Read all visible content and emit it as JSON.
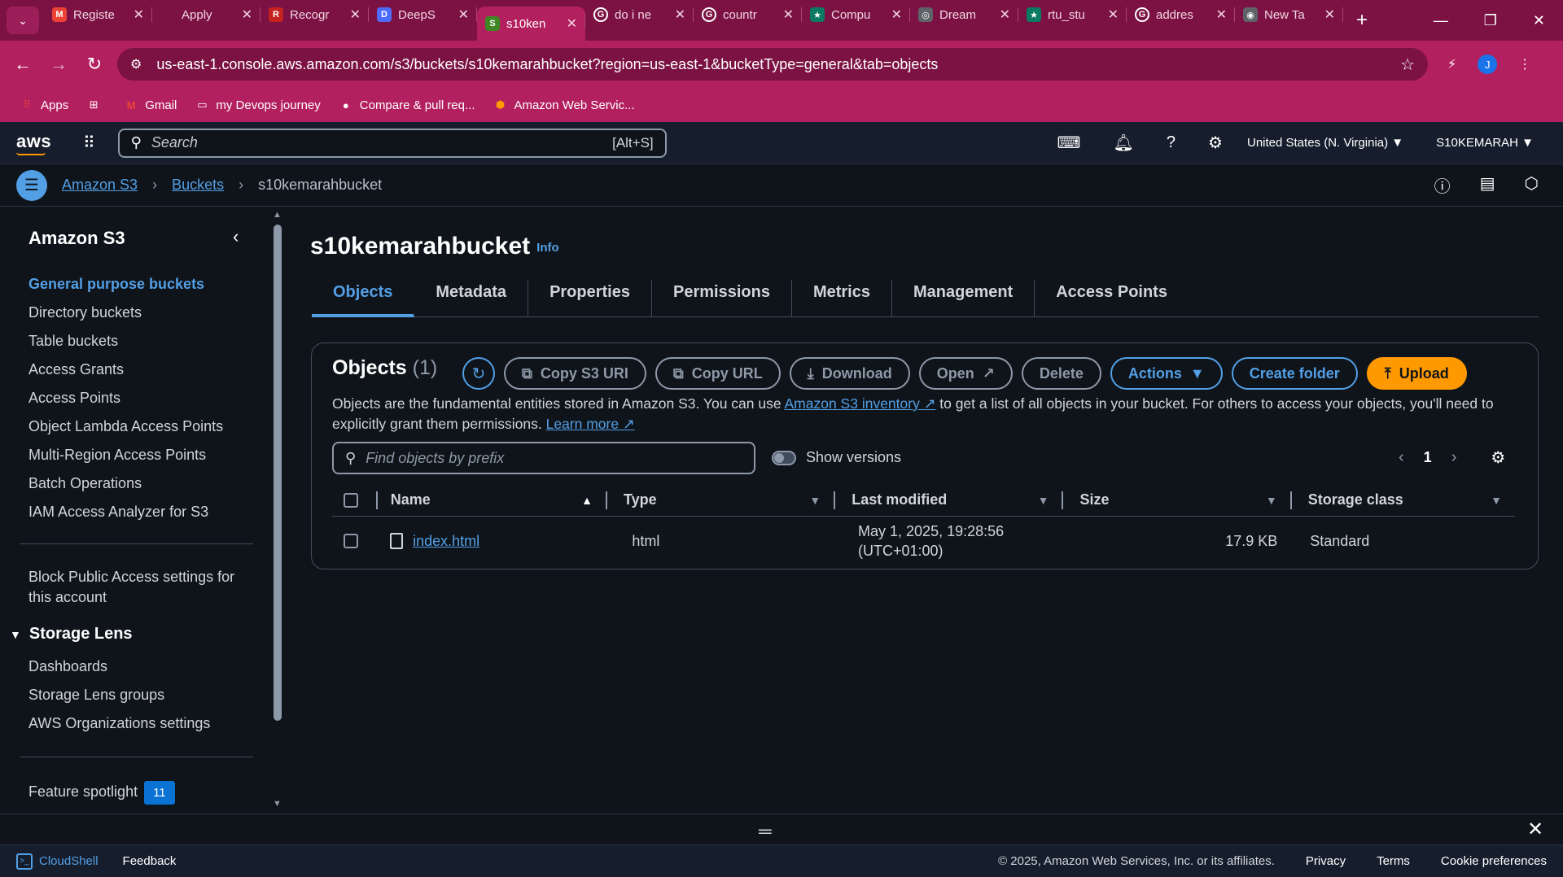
{
  "browser": {
    "tabs": [
      {
        "label": "Registe",
        "fav_color": "#ea4335",
        "fav_char": "M"
      },
      {
        "label": "Apply",
        "fav_color": "#7b1243",
        "fav_char": ""
      },
      {
        "label": "Recogr",
        "fav_color": "#c5221f",
        "fav_char": "R"
      },
      {
        "label": "DeepS",
        "fav_color": "#4d6bfe",
        "fav_char": "D"
      },
      {
        "label": "s10ken",
        "fav_color": "#3f8624",
        "fav_char": "S",
        "active": true
      },
      {
        "label": "do i ne",
        "fav_color": "#ffffff",
        "fav_char": "G"
      },
      {
        "label": "countr",
        "fav_color": "#ffffff",
        "fav_char": "G"
      },
      {
        "label": "Compu",
        "fav_color": "#0a7a62",
        "fav_char": "★"
      },
      {
        "label": "Dream",
        "fav_color": "#5f6368",
        "fav_char": "◎"
      },
      {
        "label": "rtu_stu",
        "fav_color": "#0a7a62",
        "fav_char": "★"
      },
      {
        "label": "addres",
        "fav_color": "#ffffff",
        "fav_char": "G"
      },
      {
        "label": "New Ta",
        "fav_color": "#5f6368",
        "fav_char": "◉"
      }
    ],
    "url": "us-east-1.console.aws.amazon.com/s3/buckets/s10kemarahbucket?region=us-east-1&bucketType=general&tab=objects",
    "profile_initial": "J",
    "bookmarks": [
      {
        "label": "Apps",
        "icon": "apps-grid-icon"
      },
      {
        "label": "",
        "icon": "tab-groups-icon"
      },
      {
        "label": "Gmail",
        "icon": "gmail-icon"
      },
      {
        "label": "my Devops journey",
        "icon": "folder-icon"
      },
      {
        "label": "Compare & pull req...",
        "icon": "github-icon"
      },
      {
        "label": "Amazon Web Servic...",
        "icon": "aws-cube-icon"
      }
    ]
  },
  "aws": {
    "logo": "aws",
    "search_placeholder": "Search",
    "search_shortcut": "[Alt+S]",
    "region": "United States (N. Virginia) ▼",
    "account": "S10KEMARAH ▼"
  },
  "breadcrumbs": {
    "items": [
      "Amazon S3",
      "Buckets"
    ],
    "current": "s10kemarahbucket"
  },
  "sidebar": {
    "title": "Amazon S3",
    "items": [
      {
        "label": "General purpose buckets",
        "active": true
      },
      {
        "label": "Directory buckets"
      },
      {
        "label": "Table buckets"
      },
      {
        "label": "Access Grants"
      },
      {
        "label": "Access Points"
      },
      {
        "label": "Object Lambda Access Points"
      },
      {
        "label": "Multi-Region Access Points"
      },
      {
        "label": "Batch Operations"
      },
      {
        "label": "IAM Access Analyzer for S3"
      }
    ],
    "block_public": "Block Public Access settings for this account",
    "storage_lens": "Storage Lens",
    "storage_lens_items": [
      "Dashboards",
      "Storage Lens groups",
      "AWS Organizations settings"
    ],
    "feature_spotlight": "Feature spotlight",
    "feature_spotlight_count": "11"
  },
  "main": {
    "bucket_name": "s10kemarahbucket",
    "info": "Info",
    "tabs": [
      "Objects",
      "Metadata",
      "Properties",
      "Permissions",
      "Metrics",
      "Management",
      "Access Points"
    ],
    "objects_title": "Objects",
    "objects_count": "(1)",
    "buttons": {
      "copy_s3_uri": "Copy S3 URI",
      "copy_url": "Copy URL",
      "download": "Download",
      "open": "Open",
      "delete": "Delete",
      "actions": "Actions",
      "create_folder": "Create folder",
      "upload": "Upload"
    },
    "desc_1": "Objects are the fundamental entities stored in Amazon S3. You can use ",
    "desc_link_1": "Amazon S3 inventory",
    "desc_2": " to get a list of all objects in your bucket. For others to access your objects, you'll need to explicitly grant them permissions. ",
    "desc_link_2": "Learn more",
    "find_placeholder": "Find objects by prefix",
    "show_versions": "Show versions",
    "page": "1",
    "columns": [
      "Name",
      "Type",
      "Last modified",
      "Size",
      "Storage class"
    ],
    "rows": [
      {
        "name": "index.html",
        "type": "html",
        "modified_1": "May 1, 2025, 19:28:56",
        "modified_2": "(UTC+01:00)",
        "size": "17.9 KB",
        "storage": "Standard"
      }
    ]
  },
  "footer": {
    "cloudshell": "CloudShell",
    "feedback": "Feedback",
    "copyright": "© 2025, Amazon Web Services, Inc. or its affiliates.",
    "privacy": "Privacy",
    "terms": "Terms",
    "cookies": "Cookie preferences"
  },
  "colors": {
    "accent": "#539fe5",
    "upload": "#ff9900",
    "browser_chrome": "#b3205f"
  }
}
